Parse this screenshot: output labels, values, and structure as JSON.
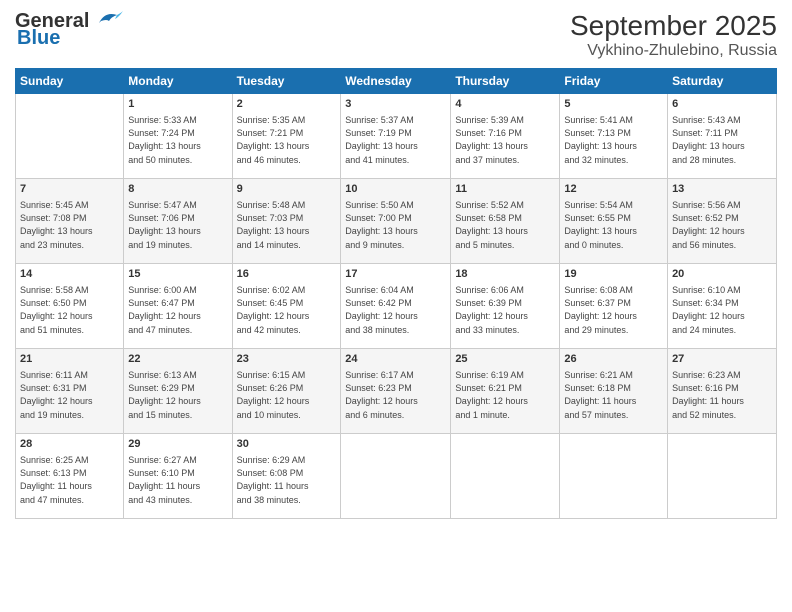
{
  "logo": {
    "line1": "General",
    "line2": "Blue"
  },
  "title": "September 2025",
  "subtitle": "Vykhino-Zhulebino, Russia",
  "days_header": [
    "Sunday",
    "Monday",
    "Tuesday",
    "Wednesday",
    "Thursday",
    "Friday",
    "Saturday"
  ],
  "weeks": [
    [
      {
        "day": "",
        "info": ""
      },
      {
        "day": "1",
        "info": "Sunrise: 5:33 AM\nSunset: 7:24 PM\nDaylight: 13 hours\nand 50 minutes."
      },
      {
        "day": "2",
        "info": "Sunrise: 5:35 AM\nSunset: 7:21 PM\nDaylight: 13 hours\nand 46 minutes."
      },
      {
        "day": "3",
        "info": "Sunrise: 5:37 AM\nSunset: 7:19 PM\nDaylight: 13 hours\nand 41 minutes."
      },
      {
        "day": "4",
        "info": "Sunrise: 5:39 AM\nSunset: 7:16 PM\nDaylight: 13 hours\nand 37 minutes."
      },
      {
        "day": "5",
        "info": "Sunrise: 5:41 AM\nSunset: 7:13 PM\nDaylight: 13 hours\nand 32 minutes."
      },
      {
        "day": "6",
        "info": "Sunrise: 5:43 AM\nSunset: 7:11 PM\nDaylight: 13 hours\nand 28 minutes."
      }
    ],
    [
      {
        "day": "7",
        "info": "Sunrise: 5:45 AM\nSunset: 7:08 PM\nDaylight: 13 hours\nand 23 minutes."
      },
      {
        "day": "8",
        "info": "Sunrise: 5:47 AM\nSunset: 7:06 PM\nDaylight: 13 hours\nand 19 minutes."
      },
      {
        "day": "9",
        "info": "Sunrise: 5:48 AM\nSunset: 7:03 PM\nDaylight: 13 hours\nand 14 minutes."
      },
      {
        "day": "10",
        "info": "Sunrise: 5:50 AM\nSunset: 7:00 PM\nDaylight: 13 hours\nand 9 minutes."
      },
      {
        "day": "11",
        "info": "Sunrise: 5:52 AM\nSunset: 6:58 PM\nDaylight: 13 hours\nand 5 minutes."
      },
      {
        "day": "12",
        "info": "Sunrise: 5:54 AM\nSunset: 6:55 PM\nDaylight: 13 hours\nand 0 minutes."
      },
      {
        "day": "13",
        "info": "Sunrise: 5:56 AM\nSunset: 6:52 PM\nDaylight: 12 hours\nand 56 minutes."
      }
    ],
    [
      {
        "day": "14",
        "info": "Sunrise: 5:58 AM\nSunset: 6:50 PM\nDaylight: 12 hours\nand 51 minutes."
      },
      {
        "day": "15",
        "info": "Sunrise: 6:00 AM\nSunset: 6:47 PM\nDaylight: 12 hours\nand 47 minutes."
      },
      {
        "day": "16",
        "info": "Sunrise: 6:02 AM\nSunset: 6:45 PM\nDaylight: 12 hours\nand 42 minutes."
      },
      {
        "day": "17",
        "info": "Sunrise: 6:04 AM\nSunset: 6:42 PM\nDaylight: 12 hours\nand 38 minutes."
      },
      {
        "day": "18",
        "info": "Sunrise: 6:06 AM\nSunset: 6:39 PM\nDaylight: 12 hours\nand 33 minutes."
      },
      {
        "day": "19",
        "info": "Sunrise: 6:08 AM\nSunset: 6:37 PM\nDaylight: 12 hours\nand 29 minutes."
      },
      {
        "day": "20",
        "info": "Sunrise: 6:10 AM\nSunset: 6:34 PM\nDaylight: 12 hours\nand 24 minutes."
      }
    ],
    [
      {
        "day": "21",
        "info": "Sunrise: 6:11 AM\nSunset: 6:31 PM\nDaylight: 12 hours\nand 19 minutes."
      },
      {
        "day": "22",
        "info": "Sunrise: 6:13 AM\nSunset: 6:29 PM\nDaylight: 12 hours\nand 15 minutes."
      },
      {
        "day": "23",
        "info": "Sunrise: 6:15 AM\nSunset: 6:26 PM\nDaylight: 12 hours\nand 10 minutes."
      },
      {
        "day": "24",
        "info": "Sunrise: 6:17 AM\nSunset: 6:23 PM\nDaylight: 12 hours\nand 6 minutes."
      },
      {
        "day": "25",
        "info": "Sunrise: 6:19 AM\nSunset: 6:21 PM\nDaylight: 12 hours\nand 1 minute."
      },
      {
        "day": "26",
        "info": "Sunrise: 6:21 AM\nSunset: 6:18 PM\nDaylight: 11 hours\nand 57 minutes."
      },
      {
        "day": "27",
        "info": "Sunrise: 6:23 AM\nSunset: 6:16 PM\nDaylight: 11 hours\nand 52 minutes."
      }
    ],
    [
      {
        "day": "28",
        "info": "Sunrise: 6:25 AM\nSunset: 6:13 PM\nDaylight: 11 hours\nand 47 minutes."
      },
      {
        "day": "29",
        "info": "Sunrise: 6:27 AM\nSunset: 6:10 PM\nDaylight: 11 hours\nand 43 minutes."
      },
      {
        "day": "30",
        "info": "Sunrise: 6:29 AM\nSunset: 6:08 PM\nDaylight: 11 hours\nand 38 minutes."
      },
      {
        "day": "",
        "info": ""
      },
      {
        "day": "",
        "info": ""
      },
      {
        "day": "",
        "info": ""
      },
      {
        "day": "",
        "info": ""
      }
    ]
  ]
}
